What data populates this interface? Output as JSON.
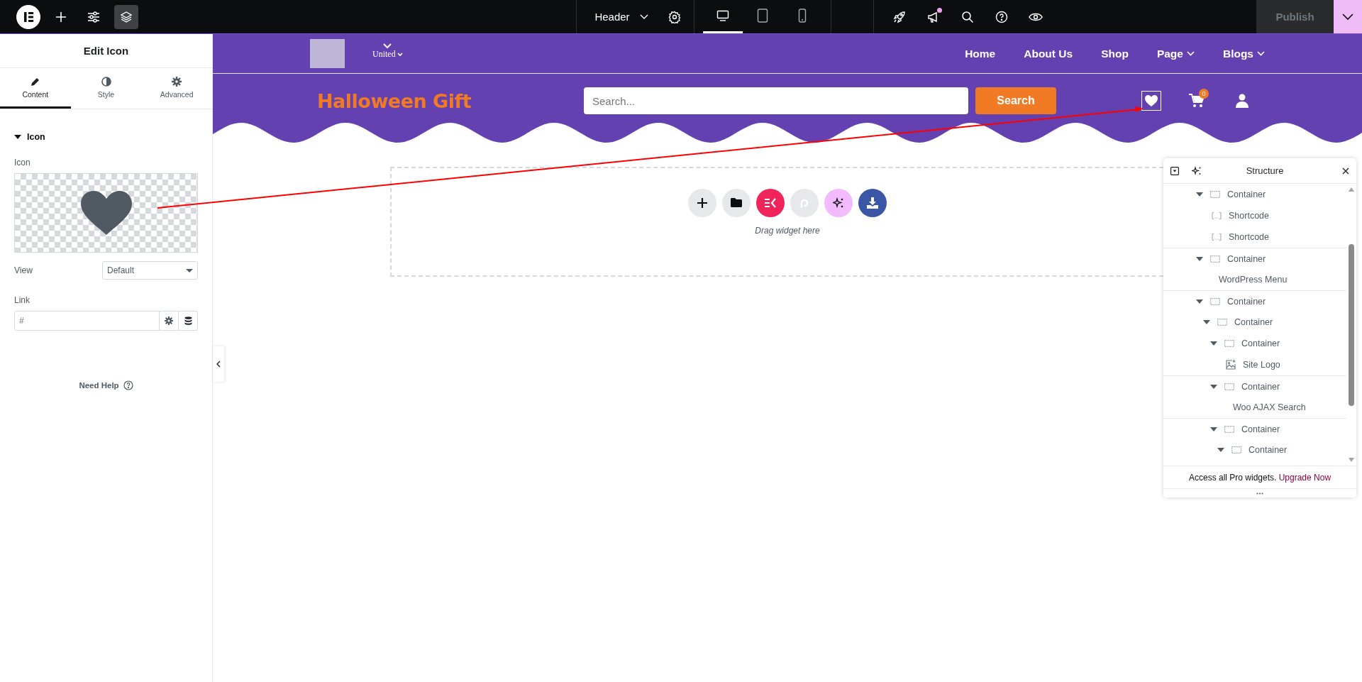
{
  "top_bar": {
    "tools": [
      {
        "kind": "add",
        "selected": false
      },
      {
        "kind": "settings",
        "selected": false
      },
      {
        "kind": "layers",
        "selected": true
      }
    ],
    "document": "Header",
    "devices": [
      {
        "kind": "desktop",
        "selected": true
      },
      {
        "kind": "tablet",
        "selected": false
      },
      {
        "kind": "mobile",
        "selected": false
      }
    ],
    "actions": [
      {
        "kind": "rocket",
        "dot": false
      },
      {
        "kind": "megaphone",
        "dot": true
      },
      {
        "kind": "search",
        "dot": false
      },
      {
        "kind": "help",
        "dot": false
      },
      {
        "kind": "preview",
        "dot": false
      }
    ],
    "publish": {
      "label": "Publish",
      "disabled": true
    }
  },
  "panel": {
    "title": "Edit Icon",
    "tabs": [
      {
        "label": "Content",
        "kind": "pencil",
        "selected": true
      },
      {
        "label": "Style",
        "kind": "contrast",
        "selected": false
      },
      {
        "label": "Advanced",
        "kind": "gear",
        "selected": false
      }
    ],
    "section": {
      "label": "Icon",
      "expanded": true
    },
    "icon_control": {
      "label": "Icon"
    },
    "view": {
      "label": "View",
      "value": "Default"
    },
    "link": {
      "label": "Link",
      "placeholder": "#"
    },
    "help": "Need Help"
  },
  "site_header": {
    "language": "United",
    "menu": [
      {
        "label": "Home",
        "dropdown": false
      },
      {
        "label": "About Us",
        "dropdown": false
      },
      {
        "label": "Shop",
        "dropdown": false
      },
      {
        "label": "Page",
        "dropdown": true
      },
      {
        "label": "Blogs",
        "dropdown": true
      }
    ],
    "logo": "Halloween Gift",
    "search": {
      "placeholder": "Search...",
      "button": "Search"
    },
    "icons": [
      {
        "kind": "heart",
        "selected": true
      },
      {
        "kind": "cart",
        "badge": "0",
        "selected": false
      },
      {
        "kind": "user",
        "selected": false
      }
    ]
  },
  "drop_zone": {
    "buttons": [
      {
        "kind": "add"
      },
      {
        "kind": "template"
      },
      {
        "kind": "kit"
      },
      {
        "kind": "pattern"
      },
      {
        "kind": "ai"
      },
      {
        "kind": "import"
      }
    ],
    "hint": "Drag widget here"
  },
  "structure": {
    "title": "Structure",
    "tree": [
      {
        "label": "Container",
        "kind": "container",
        "expanded": true,
        "children": [
          {
            "label": "Shortcode",
            "kind": "shortcode"
          },
          {
            "label": "Shortcode",
            "kind": "shortcode"
          }
        ]
      },
      {
        "label": "Container",
        "kind": "container",
        "expanded": true,
        "children": [
          {
            "label": "WordPress Menu",
            "kind": "widget"
          }
        ]
      },
      {
        "label": "Container",
        "kind": "container",
        "expanded": true,
        "children": [
          {
            "label": "Container",
            "kind": "container",
            "expanded": true,
            "children": [
              {
                "label": "Container",
                "kind": "container",
                "expanded": true,
                "children": [
                  {
                    "label": "Site Logo",
                    "kind": "image"
                  }
                ]
              },
              {
                "label": "Container",
                "kind": "container",
                "expanded": true,
                "children": [
                  {
                    "label": "Woo AJAX Search",
                    "kind": "widget"
                  }
                ]
              },
              {
                "label": "Container",
                "kind": "container",
                "expanded": true,
                "children": [
                  {
                    "label": "Container",
                    "kind": "container",
                    "expanded": true
                  }
                ]
              }
            ]
          }
        ]
      }
    ],
    "promo": "Access all Pro widgets.",
    "upgrade": "Upgrade Now"
  }
}
